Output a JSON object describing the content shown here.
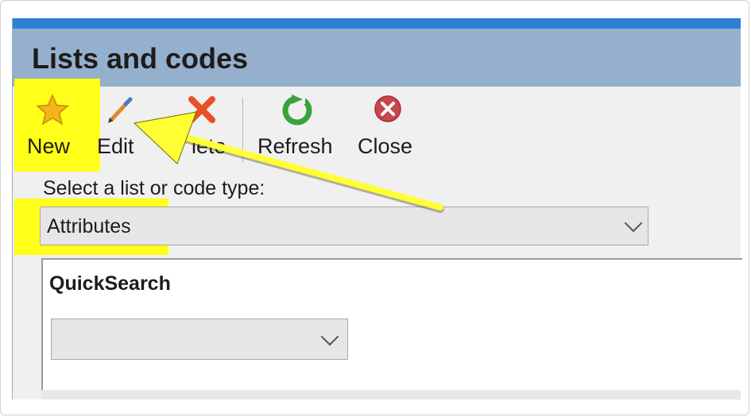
{
  "window": {
    "title": "Lists and codes"
  },
  "toolbar": {
    "new_label": "New",
    "edit_label": "Edit",
    "delete_label": "lete",
    "refresh_label": "Refresh",
    "close_label": "Close"
  },
  "selector": {
    "label": "Select a list or code type:",
    "value": "Attributes"
  },
  "quicksearch": {
    "title": "QuickSearch",
    "value": ""
  },
  "icons": {
    "new": "star-icon",
    "edit": "pencil-icon",
    "delete": "red-x-icon",
    "refresh": "green-refresh-icon",
    "close": "red-close-circle-icon",
    "dropdown": "chevron-down-icon"
  },
  "colors": {
    "highlight": "#ffff1a",
    "arrow": "#ffff33",
    "title_bar": "#94b0cd",
    "accent_line": "#2f7fd7"
  }
}
